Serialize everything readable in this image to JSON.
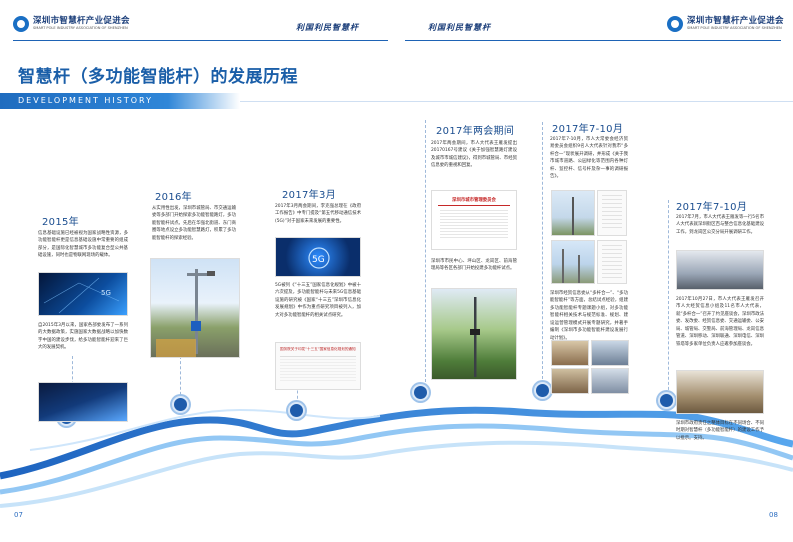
{
  "header": {
    "left_logo_cn": "深圳市智慧杆产业促进会",
    "left_logo_en": "SMART POLE INDUSTRY ASSOCIATION OF SHENZHEN",
    "slogan_left": "利国利民智慧杆",
    "slogan_right": "利国利民智慧杆",
    "right_logo_cn": "深圳市智慧杆产业促进会",
    "right_logo_en": "SMART POLE INDUSTRY ASSOCIATION OF SHENZHEN"
  },
  "page": {
    "title": "智慧杆（多功能智能杆）的发展历程",
    "subtitle_en": "DEVELOPMENT HISTORY",
    "page_left": "07",
    "page_right": "08"
  },
  "timeline": [
    {
      "year": "2015年",
      "text1": "信息基础设施已经被视为国家战略性资源，多功能智能杆更是信息基础设施中常重要的组成部分，是国际化智慧城市多功能复合型公共基础设施，同时也是物联网现场的载体。",
      "text2": "自2015年3月以来，国家各部委发布了一系列的大数据政策，实施国家大数据战略以加快数字中国的建设步伐，给多功能智能杆迎来了巨大的发展契机。"
    },
    {
      "year": "2016年",
      "text1": "从实用性出发，深圳市城管局、市交通运输委等多部门开始探索多功能智能路灯，多功能智能杆试点。先后在华强北街道、东门商圈等地点设立多功能智慧路灯，积累了多功能智能杆的探索经验。"
    },
    {
      "year": "2017年3月",
      "text1": "2017年3月两会期间，李克强总理在《政府工作报告》中专门提及“第五代移动通信技术(5G)”对于国家未来发展的重要性。",
      "text2": "5G被列《“十三五”国家信息化规划》中被十六次提及，多功能智能杆与未来5G信息基础设施的研究被《国家“十三五”深圳市信息化发展规划》中作为重点研究项目被列入，加大对多功能智能杆的相关试点研究。",
      "doc_caption": "国务院关于印发“十三五”国家信息化规划的通知"
    },
    {
      "year": "2017年两会期间",
      "text1": "2017年两会期间，市人大代表王雁发提出20170167号建议《关于加强智慧路灯建设及城市市城信建议》，得到市城管局、市经贸信息委的重视和回复。",
      "text2": "深圳市市民中心、坪山区、龙岗区、前海管理局等各区各部门开始投建多功能杆试点。",
      "doc_caption": "深圳市城市管理委员会"
    },
    {
      "year": "2017年7-10月",
      "text1": "2017年7-10月，市人大常委会经济贸易委员会组织9名人大代表针对我市“多杆合一”现状展开调研，并形成《关于我市城市道路、公园绿化等范围内各种灯杆、监控杆、信号杆及杂一事的调研报告》。",
      "text2": "深圳市经贸信息委从“多杆合一”、“多功能智能杆”等方面，总结试点经验，组建多功能智能杆专题课题小组，对多功能智能杆相关技术与规范标准、规划、建设运营管理模式开展专题研究，并著手编制《深圳市多功能智能杆建设发展行动计划》。"
    },
    {
      "year": "2017年7-10月",
      "text1": "2017年7月，市人大代表王雁发等一行5名市人大代表就深圳街区百与整合信息化基础建设工作，到龙岗区公交分局开展调研工作。",
      "text2": "2017年10月27日，市人大代表王雁发召开市人大经贸信息小组及11名市人大代表，就“多杆合一”召开了约见座谈会，深圳市政法委、发改委、经贸信息委、交通运输委、公安局、城管局、交警局、前海管理局、龙岗信息管道、深圳移动、深圳联通、深圳电信、深圳铁塔等多家单位负责人应邀参加座谈会。",
      "text3": "深圳市政府责任之整体目标在不同场合、不同时期对智慧杆（多功能智能杆）的建设工作予以批示。支持。"
    }
  ],
  "colors": {
    "primary": "#1a5ea8",
    "accent": "#2f86d8",
    "dot": "#1f5cab"
  },
  "icons": [
    "logo-emblem-icon",
    "5g-badge-icon"
  ]
}
